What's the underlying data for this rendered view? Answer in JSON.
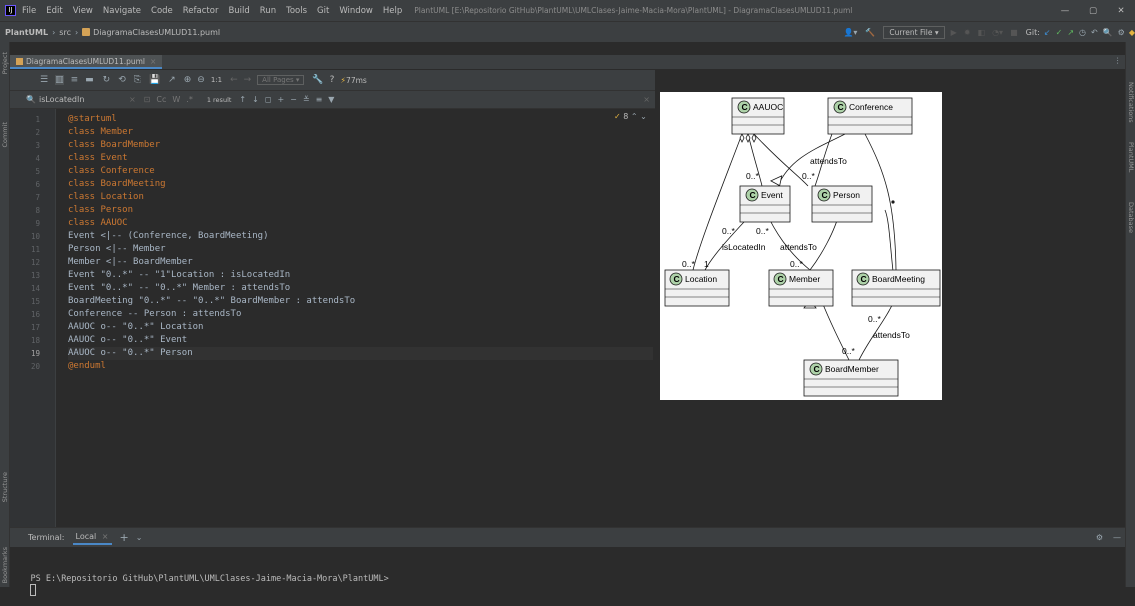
{
  "window": {
    "app_icon": "intellij-icon",
    "menu": [
      "File",
      "Edit",
      "View",
      "Navigate",
      "Code",
      "Refactor",
      "Build",
      "Run",
      "Tools",
      "Git",
      "Window",
      "Help"
    ],
    "title": "PlantUML [E:\\Repositorio GitHub\\PlantUML\\UMLClases-Jaime-Macia-Mora\\PlantUML] - DiagramaClasesUMLUD11.puml",
    "controls": [
      "—",
      "▢",
      "✕"
    ]
  },
  "breadcrumb": {
    "project": "PlantUML",
    "folder": "src",
    "file": "DiagramaClasesUMLUD11.puml"
  },
  "navtoolbar": {
    "current_file": "Current File ▾",
    "git_label": "Git:"
  },
  "sidebar_left": {
    "project": "Project",
    "commit": "Commit",
    "structure": "Structure",
    "bookmarks": "Bookmarks"
  },
  "sidebar_right": {
    "notifications": "Notifications",
    "plantuml": "PlantUML",
    "database": "Database"
  },
  "tab": {
    "label": "DiagramaClasesUMLUD11.puml"
  },
  "editor_toolbar": {
    "zoom": "1:1",
    "pages": "All Pages ▾",
    "time": "77ms",
    "help": "?"
  },
  "search": {
    "query": "isLocatedIn",
    "options": [
      "Cc",
      "W",
      ".*"
    ],
    "result_count": "1 result"
  },
  "editor": {
    "warnings": "8",
    "lines": [
      {
        "n": "1",
        "text": "@startuml"
      },
      {
        "n": "2",
        "text": "class Member"
      },
      {
        "n": "3",
        "text": "class BoardMember"
      },
      {
        "n": "4",
        "text": "class Event"
      },
      {
        "n": "5",
        "text": "class Conference"
      },
      {
        "n": "6",
        "text": "class BoardMeeting"
      },
      {
        "n": "7",
        "text": "class Location"
      },
      {
        "n": "8",
        "text": "class Person"
      },
      {
        "n": "9",
        "text": "class AAUOC"
      },
      {
        "n": "10",
        "text": "Event <|-- (Conference, BoardMeeting)"
      },
      {
        "n": "11",
        "text": "Person <|-- Member"
      },
      {
        "n": "12",
        "text": "Member <|-- BoardMember"
      },
      {
        "n": "13",
        "text": "Event \"0..*\" -- \"1\"Location : isLocatedIn"
      },
      {
        "n": "14",
        "text": "Event \"0..*\" -- \"0..*\" Member : attendsTo"
      },
      {
        "n": "15",
        "text": "BoardMeeting \"0..*\" -- \"0..*\" BoardMember : attendsTo"
      },
      {
        "n": "16",
        "text": "Conference -- Person : attendsTo"
      },
      {
        "n": "17",
        "text": "AAUOC o-- \"0..*\" Location"
      },
      {
        "n": "18",
        "text": "AAUOC o-- \"0..*\" Event"
      },
      {
        "n": "19",
        "text": "AAUOC o-- \"0..*\" Person"
      },
      {
        "n": "20",
        "text": "@enduml"
      }
    ]
  },
  "diagram": {
    "classes": {
      "aauoc": "AAUOC",
      "conference": "Conference",
      "event": "Event",
      "person": "Person",
      "location": "Location",
      "member": "Member",
      "boardmeeting": "BoardMeeting",
      "boardmember": "BoardMember"
    },
    "stereotype_letter": "C",
    "labels": {
      "attends_conf": "attendsTo",
      "attends_member": "attendsTo",
      "attends_board": "attendsTo",
      "is_located_in": "isLocatedIn",
      "m1": "0..*",
      "m2": "0..*",
      "m3": "0..*",
      "m4": "0..*",
      "m5": "0..*",
      "m6": "0..*",
      "m7": "1",
      "m8": "0..*",
      "m9": "0..*"
    }
  },
  "terminal": {
    "tab_title": "Terminal:",
    "tab_local": "Local",
    "prompt": "PS E:\\Repositorio GitHub\\PlantUML\\UMLClases-Jaime-Macia-Mora\\PlantUML>"
  },
  "colors": {
    "keyword": "#cc7832",
    "class_green": "#add1a8",
    "bg_editor": "#2b2b2b",
    "bg_chrome": "#3c3f41"
  }
}
